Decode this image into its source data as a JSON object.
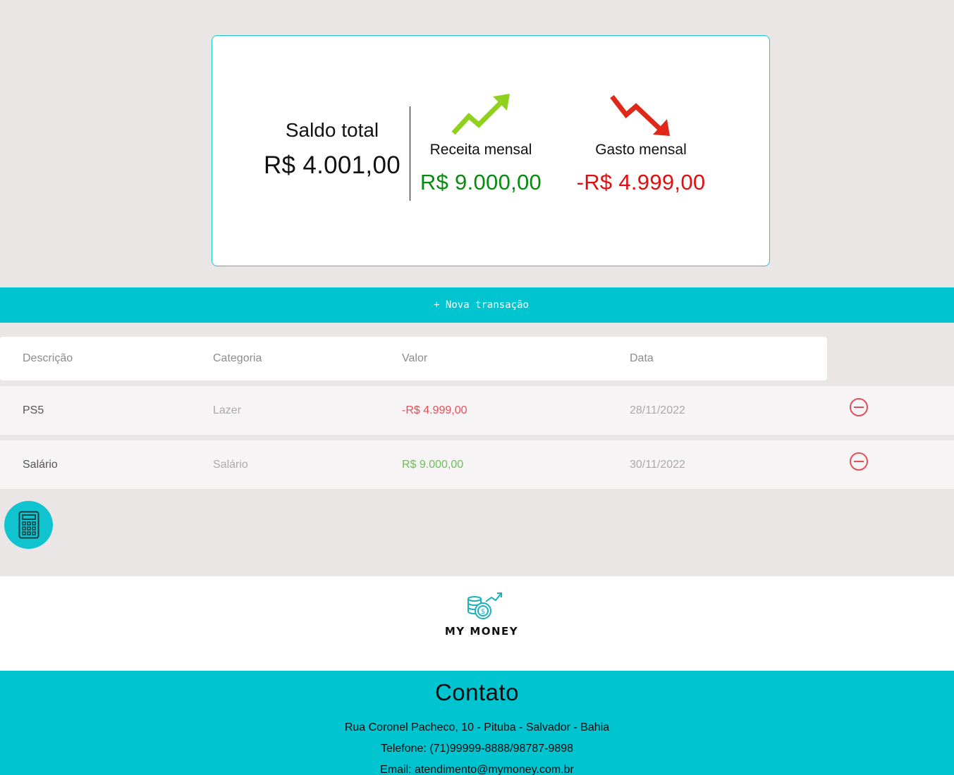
{
  "summary": {
    "saldo_label": "Saldo total",
    "saldo_value": "R$ 4.001,00",
    "receita_label": "Receita mensal",
    "receita_value": "R$ 9.000,00",
    "gasto_label": "Gasto mensal",
    "gasto_value": "-R$ 4.999,00",
    "receita_icon": "trend-up-icon",
    "gasto_icon": "trend-down-icon"
  },
  "new_transaction_label": "+ Nova transação",
  "table": {
    "headers": [
      "Descrição",
      "Categoria",
      "Valor",
      "Data"
    ],
    "rows": [
      {
        "descricao": "PS5",
        "categoria": "Lazer",
        "valor": "-R$ 4.999,00",
        "data": "28/11/2022",
        "type": "expense"
      },
      {
        "descricao": "Salário",
        "categoria": "Salário",
        "valor": "R$ 9.000,00",
        "data": "30/11/2022",
        "type": "income"
      }
    ]
  },
  "calculator_icon": "calculator-icon",
  "logo": {
    "text": "MY MONEY"
  },
  "footer": {
    "title": "Contato",
    "address": "Rua Coronel Pacheco, 10 - Pituba - Salvador - Bahia",
    "phone": "Telefone: (71)99999-8888/98787-9898",
    "email": "Email: atendimento@mymoney.com.br"
  },
  "colors": {
    "accent": "#00c4d0",
    "income": "#098a10",
    "expense": "#e01010",
    "background": "#ebe6e6"
  }
}
